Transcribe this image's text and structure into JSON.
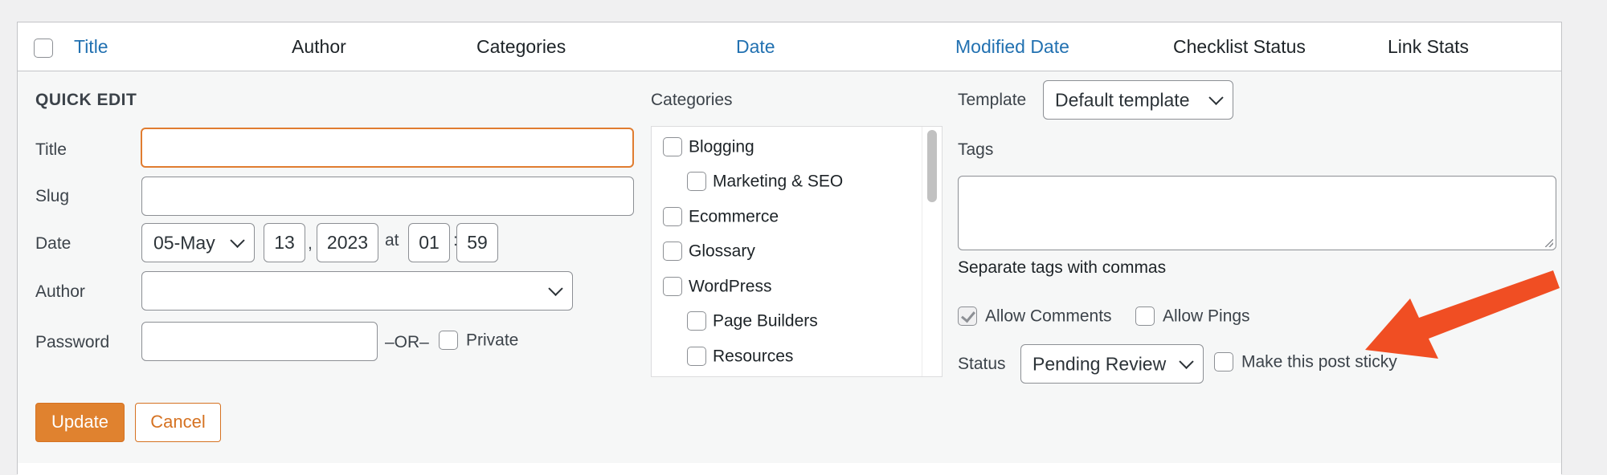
{
  "table_header": {
    "columns": [
      {
        "label": "Title",
        "sortable": true
      },
      {
        "label": "Author",
        "sortable": false
      },
      {
        "label": "Categories",
        "sortable": false
      },
      {
        "label": "Date",
        "sortable": true
      },
      {
        "label": "Modified Date",
        "sortable": true
      },
      {
        "label": "Checklist Status",
        "sortable": false
      },
      {
        "label": "Link Stats",
        "sortable": false
      }
    ]
  },
  "quick_edit": {
    "heading": "QUICK EDIT",
    "title": {
      "label": "Title",
      "value": ""
    },
    "slug": {
      "label": "Slug",
      "value": ""
    },
    "date": {
      "label": "Date",
      "month": "05-May",
      "day": "13",
      "year": "2023",
      "at": "at",
      "hour": "01",
      "minute": "59",
      "comma": ",",
      "colon": ":"
    },
    "author": {
      "label": "Author",
      "value": ""
    },
    "password": {
      "label": "Password",
      "value": "",
      "or_text": "–OR–",
      "private_label": "Private",
      "private_checked": false
    },
    "categories": {
      "label": "Categories",
      "items": [
        {
          "label": "Blogging",
          "checked": false,
          "child": false
        },
        {
          "label": "Marketing & SEO",
          "checked": false,
          "child": true
        },
        {
          "label": "Ecommerce",
          "checked": false,
          "child": false
        },
        {
          "label": "Glossary",
          "checked": false,
          "child": false
        },
        {
          "label": "WordPress",
          "checked": false,
          "child": false
        },
        {
          "label": "Page Builders",
          "checked": false,
          "child": true
        },
        {
          "label": "Resources",
          "checked": false,
          "child": true
        }
      ]
    },
    "template": {
      "label": "Template",
      "value": "Default template"
    },
    "tags": {
      "label": "Tags",
      "value": "",
      "hint": "Separate tags with commas"
    },
    "allow_comments": {
      "label": "Allow Comments",
      "checked": true
    },
    "allow_pings": {
      "label": "Allow Pings",
      "checked": false
    },
    "status": {
      "label": "Status",
      "value": "Pending Review"
    },
    "sticky": {
      "label": "Make this post sticky",
      "checked": false
    },
    "buttons": {
      "update": "Update",
      "cancel": "Cancel"
    }
  },
  "colors": {
    "accent": "#e0822f",
    "link": "#2271b1",
    "annotation_arrow": "#f04e23"
  },
  "annotation": {
    "icon": "arrow-icon"
  }
}
